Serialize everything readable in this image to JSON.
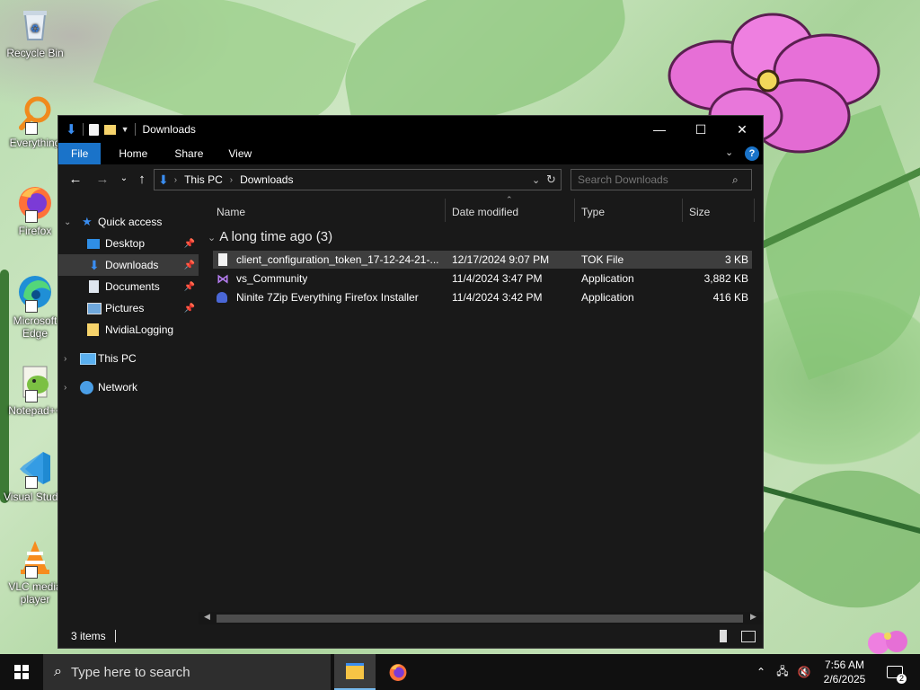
{
  "desktop": {
    "icons": [
      {
        "label": "Recycle Bin"
      },
      {
        "label": "Everything"
      },
      {
        "label": "Firefox"
      },
      {
        "label": "Microsoft Edge"
      },
      {
        "label": "Notepad++"
      },
      {
        "label": "Visual Studio Code"
      },
      {
        "label": "VLC media player"
      }
    ]
  },
  "window": {
    "title": "Downloads",
    "controls": {
      "minimize": "—",
      "maximize": "☐",
      "close": "✕"
    }
  },
  "ribbon": {
    "tabs": [
      "File",
      "Home",
      "Share",
      "View"
    ]
  },
  "address": {
    "segments": [
      "This PC",
      "Downloads"
    ]
  },
  "search": {
    "placeholder": "Search Downloads"
  },
  "sidebar": {
    "quick_access": "Quick access",
    "items": [
      {
        "label": "Desktop"
      },
      {
        "label": "Downloads"
      },
      {
        "label": "Documents"
      },
      {
        "label": "Pictures"
      },
      {
        "label": "NvidiaLogging"
      }
    ],
    "this_pc": "This PC",
    "network": "Network"
  },
  "columns": {
    "name": "Name",
    "date": "Date modified",
    "type": "Type",
    "size": "Size"
  },
  "group": {
    "label": "A long time ago (3)"
  },
  "files": [
    {
      "name": "client_configuration_token_17-12-24-21-...",
      "date": "12/17/2024 9:07 PM",
      "type": "TOK File",
      "size": "3 KB"
    },
    {
      "name": "vs_Community",
      "date": "11/4/2024 3:47 PM",
      "type": "Application",
      "size": "3,882 KB"
    },
    {
      "name": "Ninite 7Zip Everything Firefox Installer",
      "date": "11/4/2024 3:42 PM",
      "type": "Application",
      "size": "416 KB"
    }
  ],
  "status": {
    "count": "3 items"
  },
  "taskbar": {
    "search_placeholder": "Type here to search",
    "time": "7:56 AM",
    "date": "2/6/2025",
    "notifications": "2"
  },
  "colors": {
    "accent": "#1a73c9",
    "window_bg": "#191919",
    "selection": "#3a3a3a"
  }
}
